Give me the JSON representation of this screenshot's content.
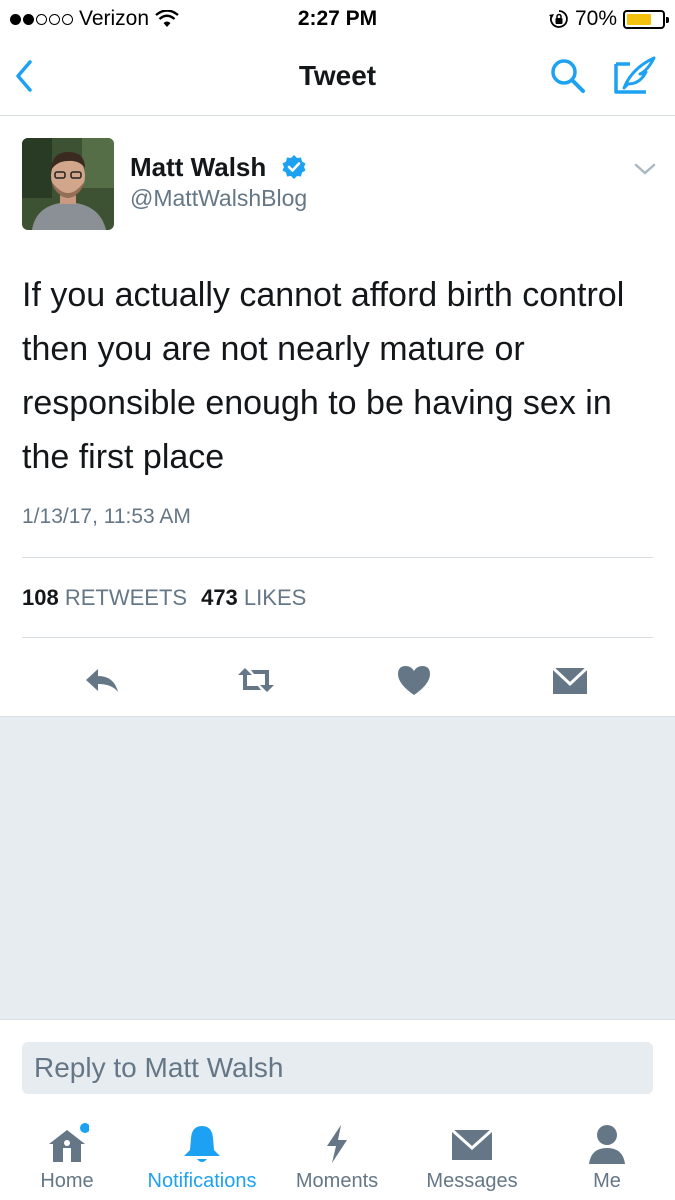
{
  "status_bar": {
    "carrier": "Verizon",
    "time": "2:27 PM",
    "battery": "70%",
    "battery_level": 0.7
  },
  "nav": {
    "title": "Tweet",
    "back_icon": "chevron-left-icon",
    "search_icon": "search-icon",
    "compose_icon": "compose-icon"
  },
  "tweet": {
    "author_name": "Matt Walsh",
    "author_handle": "@MattWalshBlog",
    "verified": true,
    "text": "If you actually cannot afford birth control then you are not nearly mature or responsible enough to be having sex in the first place",
    "timestamp": "1/13/17, 11:53 AM",
    "retweet_count": "108",
    "retweet_label": "RETWEETS",
    "like_count": "473",
    "like_label": "LIKES"
  },
  "reply": {
    "placeholder": "Reply to Matt Walsh"
  },
  "tab_bar": {
    "items": [
      {
        "label": "Home",
        "icon": "home-icon",
        "active": false,
        "has_dot": true
      },
      {
        "label": "Notifications",
        "icon": "bell-icon",
        "active": true
      },
      {
        "label": "Moments",
        "icon": "lightning-icon",
        "active": false
      },
      {
        "label": "Messages",
        "icon": "envelope-icon",
        "active": false
      },
      {
        "label": "Me",
        "icon": "person-icon",
        "active": false
      }
    ]
  },
  "colors": {
    "accent": "#1da1f2",
    "icon_gray": "#657786",
    "divider": "#d8dde1",
    "background_gray": "#e6ecf0"
  }
}
